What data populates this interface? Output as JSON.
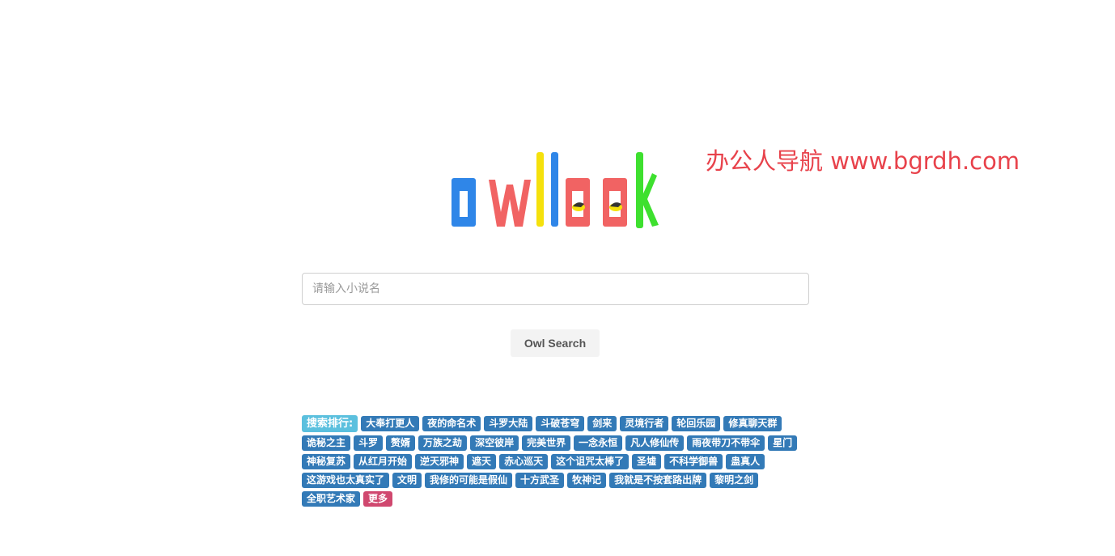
{
  "watermark": "办公人导航 www.bgrdh.com",
  "logo": {
    "alt": "owllook",
    "colors": {
      "o1": "#2f86e8",
      "w": "#f16363",
      "l1": "#f5e10c",
      "l2": "#2f86e8",
      "o2": "#f16363",
      "o3": "#f16363",
      "k": "#3ee02f"
    }
  },
  "search": {
    "placeholder": "请输入小说名",
    "button_label": "Owl Search"
  },
  "ranking": {
    "label": "搜索排行:",
    "items": [
      "大奉打更人",
      "夜的命名术",
      "斗罗大陆",
      "斗破苍穹",
      "剑来",
      "灵境行者",
      "轮回乐园",
      "修真聊天群",
      "诡秘之主",
      "斗罗",
      "赘婿",
      "万族之劫",
      "深空彼岸",
      "完美世界",
      "一念永恒",
      "凡人修仙传",
      "雨夜带刀不带伞",
      "星门",
      "神秘复苏",
      "从红月开始",
      "逆天邪神",
      "遮天",
      "赤心巡天",
      "这个诅咒太棒了",
      "圣墟",
      "不科学御兽",
      "蛊真人",
      "这游戏也太真实了",
      "文明",
      "我修的可能是假仙",
      "十方武圣",
      "牧神记",
      "我就是不按套路出牌",
      "黎明之剑",
      "全职艺术家"
    ],
    "more_label": "更多"
  }
}
